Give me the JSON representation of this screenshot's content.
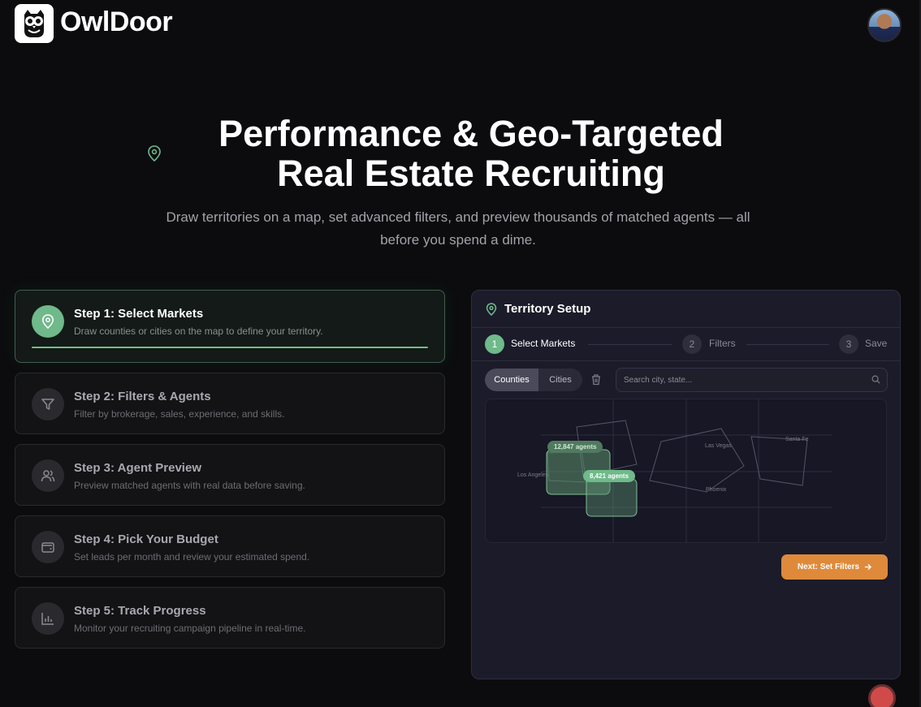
{
  "brand": {
    "name": "OwlDoor"
  },
  "hero": {
    "title_line1": "Performance & Geo-Targeted",
    "title_line2": "Real Estate Recruiting",
    "subtitle_line1": "Draw territories on a map, set advanced filters, and preview thousands of matched agents — all",
    "subtitle_line2": "before you spend a dime."
  },
  "steps": [
    {
      "title": "Step 1: Select Markets",
      "desc": "Draw counties or cities on the map to define your territory.",
      "icon": "map-pin-icon",
      "active": true
    },
    {
      "title": "Step 2: Filters & Agents",
      "desc": "Filter by brokerage, sales, experience, and skills.",
      "icon": "filter-icon"
    },
    {
      "title": "Step 3: Agent Preview",
      "desc": "Preview matched agents with real data before saving.",
      "icon": "users-icon"
    },
    {
      "title": "Step 4: Pick Your Budget",
      "desc": "Set leads per month and review your estimated spend.",
      "icon": "wallet-icon"
    },
    {
      "title": "Step 5: Track Progress",
      "desc": "Monitor your recruiting campaign pipeline in real-time.",
      "icon": "bar-chart-icon"
    }
  ],
  "panel": {
    "title": "Territory Setup",
    "wizard": [
      {
        "num": "1",
        "label": "Select Markets",
        "active": true
      },
      {
        "num": "2",
        "label": "Filters"
      },
      {
        "num": "3",
        "label": "Save"
      }
    ],
    "toggle": {
      "counties": "Counties",
      "cities": "Cities",
      "selected": "Counties"
    },
    "search_placeholder": "Search city, state...",
    "map": {
      "cities": [
        "Las Vegas",
        "Santa Fe",
        "Los Angeles",
        "Phoenix"
      ],
      "badges": [
        "12,847 agents",
        "8,421 agents"
      ]
    },
    "next_button": "Next: Set Filters"
  },
  "colors": {
    "accent_green": "#6fb98a",
    "accent_orange": "#df8a3a",
    "background": "#0c0c0f"
  }
}
